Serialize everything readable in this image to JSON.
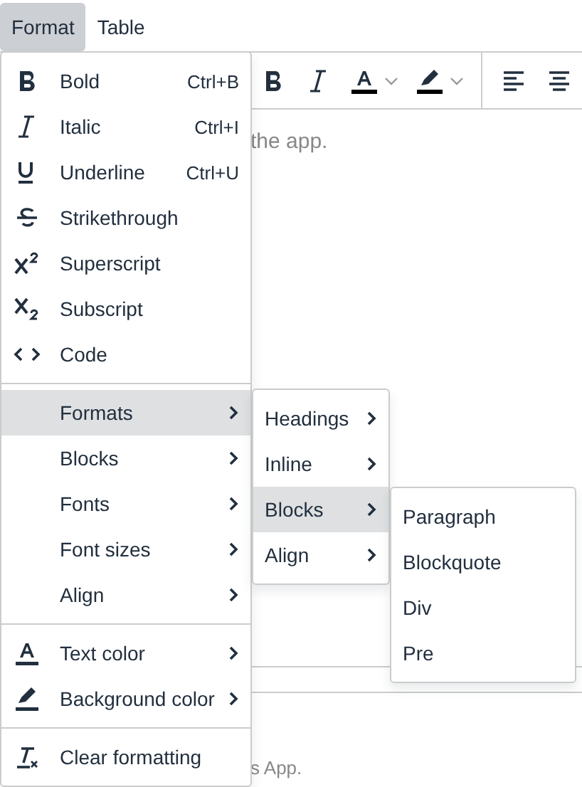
{
  "menubar": [
    {
      "label": "Format",
      "selected": true
    },
    {
      "label": "Table",
      "selected": false
    }
  ],
  "editor": {
    "text_top": "the app.",
    "text_bottom": "s App."
  },
  "format_menu": {
    "groups": [
      [
        {
          "kind": "command",
          "label": "Bold",
          "shortcut": "Ctrl+B",
          "selected": false
        },
        {
          "kind": "command",
          "label": "Italic",
          "shortcut": "Ctrl+I",
          "selected": false
        },
        {
          "kind": "command",
          "label": "Underline",
          "shortcut": "Ctrl+U",
          "selected": false
        },
        {
          "kind": "command",
          "label": "Strikethrough",
          "selected": false
        },
        {
          "kind": "command",
          "label": "Superscript",
          "selected": false
        },
        {
          "kind": "command",
          "label": "Subscript",
          "selected": false
        },
        {
          "kind": "command",
          "label": "Code",
          "selected": false
        }
      ],
      [
        {
          "kind": "submenu",
          "label": "Formats",
          "selected": true
        },
        {
          "kind": "submenu",
          "label": "Blocks",
          "selected": false
        },
        {
          "kind": "submenu",
          "label": "Fonts",
          "selected": false
        },
        {
          "kind": "submenu",
          "label": "Font sizes",
          "selected": false
        },
        {
          "kind": "submenu",
          "label": "Align",
          "selected": false
        }
      ],
      [
        {
          "kind": "submenu",
          "label": "Text color",
          "selected": false
        },
        {
          "kind": "submenu",
          "label": "Background color",
          "selected": false
        }
      ],
      [
        {
          "kind": "command",
          "label": "Clear formatting",
          "selected": false
        }
      ]
    ]
  },
  "formats_submenu": [
    {
      "kind": "submenu",
      "label": "Headings",
      "selected": false
    },
    {
      "kind": "submenu",
      "label": "Inline",
      "selected": false
    },
    {
      "kind": "submenu",
      "label": "Blocks",
      "selected": true
    },
    {
      "kind": "submenu",
      "label": "Align",
      "selected": false
    }
  ],
  "blocks_submenu": [
    {
      "kind": "command",
      "label": "Paragraph",
      "selected": false
    },
    {
      "kind": "command",
      "label": "Blockquote",
      "selected": false
    },
    {
      "kind": "command",
      "label": "Div",
      "selected": false
    },
    {
      "kind": "command",
      "label": "Pre",
      "selected": false
    }
  ]
}
